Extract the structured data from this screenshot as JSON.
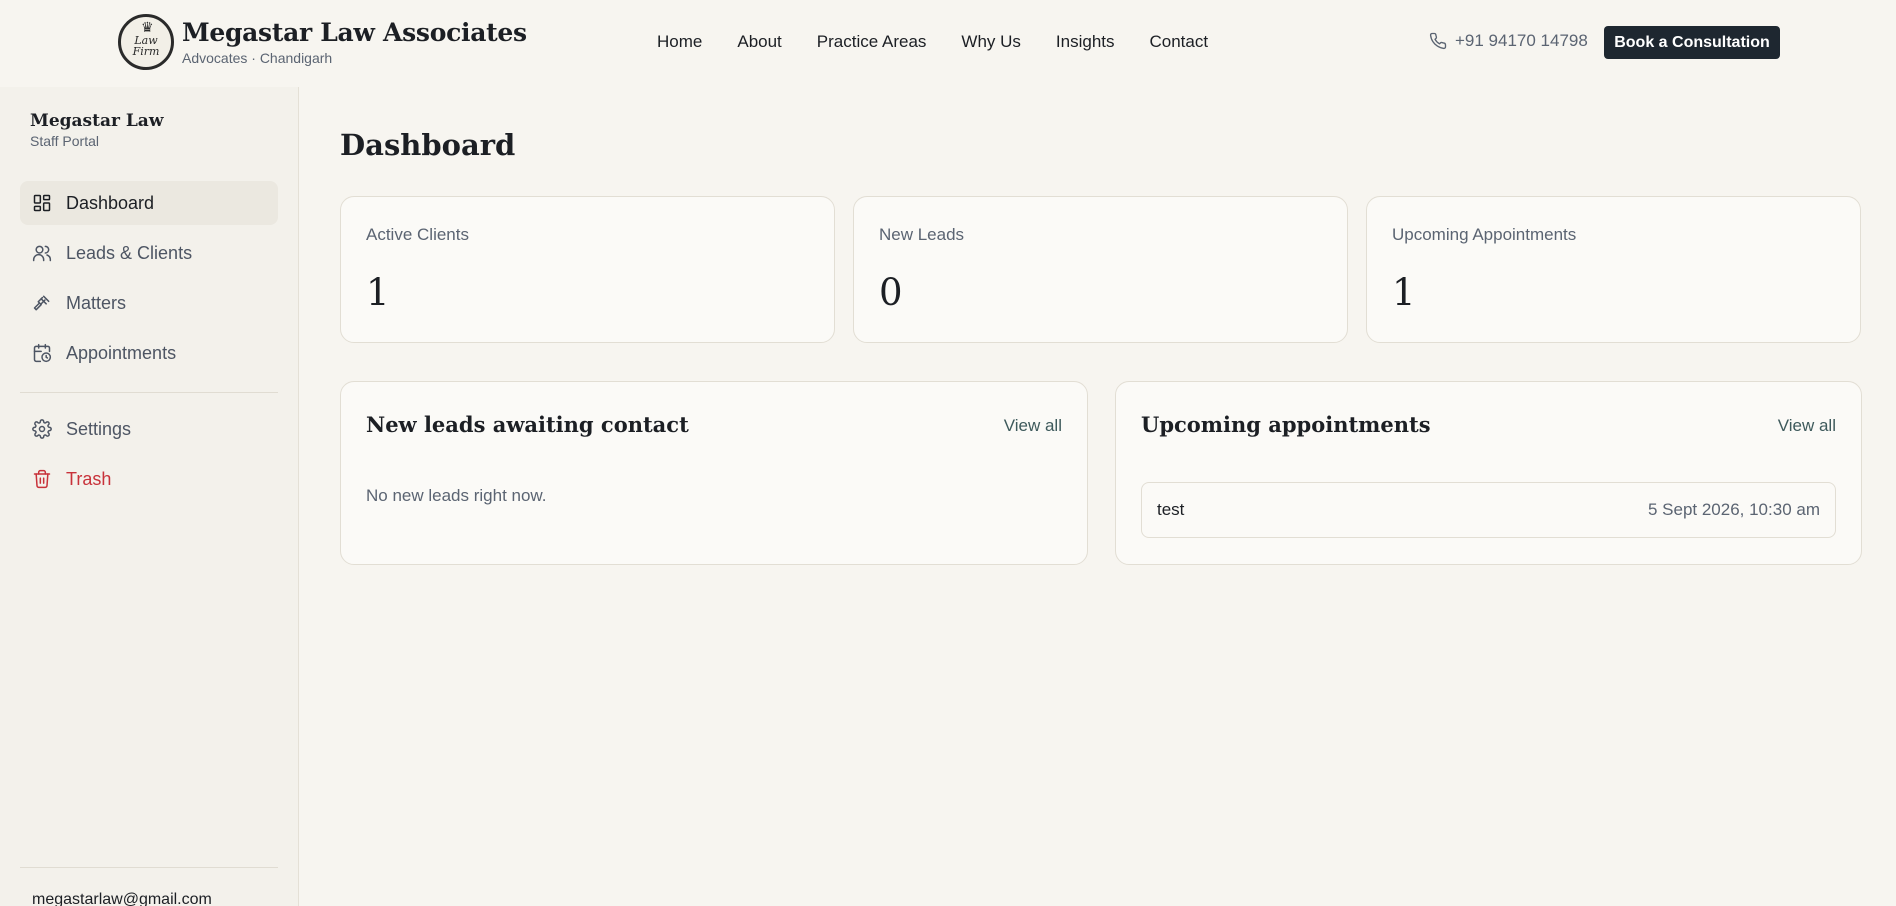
{
  "header": {
    "brand_title": "Megastar Law Associates",
    "brand_subtitle": "Advocates · Chandigarh",
    "logo_text": "Law Firm",
    "nav": [
      "Home",
      "About",
      "Practice Areas",
      "Why Us",
      "Insights",
      "Contact"
    ],
    "phone": "+91 94170 14798",
    "cta_label": "Book a Consultation"
  },
  "sidebar": {
    "title": "Megastar Law",
    "subtitle": "Staff Portal",
    "items": [
      {
        "label": "Dashboard",
        "icon": "dashboard-icon",
        "active": true
      },
      {
        "label": "Leads & Clients",
        "icon": "users-icon"
      },
      {
        "label": "Matters",
        "icon": "gavel-icon"
      },
      {
        "label": "Appointments",
        "icon": "calendar-clock-icon"
      },
      {
        "label": "Settings",
        "icon": "gear-icon"
      },
      {
        "label": "Trash",
        "icon": "trash-icon"
      }
    ],
    "email": "megastarlaw@gmail.com"
  },
  "main": {
    "title": "Dashboard",
    "stats": [
      {
        "label": "Active Clients",
        "value": "1"
      },
      {
        "label": "New Leads",
        "value": "0"
      },
      {
        "label": "Upcoming Appointments",
        "value": "1"
      }
    ],
    "leads_panel": {
      "title": "New leads awaiting contact",
      "link": "View all",
      "empty": "No new leads right now."
    },
    "appointments_panel": {
      "title": "Upcoming appointments",
      "link": "View all",
      "rows": [
        {
          "name": "test",
          "time": "5 Sept 2026, 10:30 am"
        }
      ]
    }
  },
  "colors": {
    "background": "#f7f5f0",
    "sidebar": "#f3f1eb",
    "cta": "#1e2730",
    "danger": "#c8323a"
  }
}
